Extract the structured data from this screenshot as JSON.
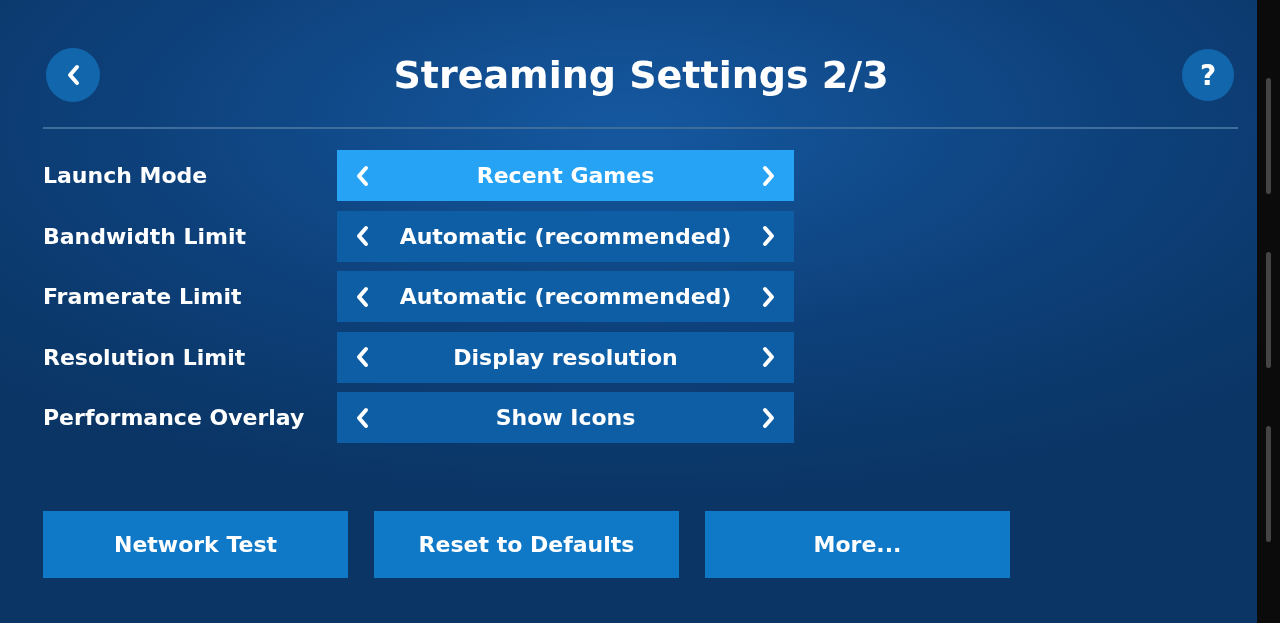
{
  "header": {
    "title": "Streaming Settings 2/3",
    "help_label": "?"
  },
  "settings": [
    {
      "label": "Launch Mode",
      "value": "Recent Games",
      "selected": true
    },
    {
      "label": "Bandwidth Limit",
      "value": "Automatic (recommended)",
      "selected": false
    },
    {
      "label": "Framerate Limit",
      "value": "Automatic (recommended)",
      "selected": false
    },
    {
      "label": "Resolution Limit",
      "value": "Display resolution",
      "selected": false
    },
    {
      "label": "Performance Overlay",
      "value": "Show Icons",
      "selected": false
    }
  ],
  "buttons": [
    "Network Test",
    "Reset to Defaults",
    "More..."
  ]
}
